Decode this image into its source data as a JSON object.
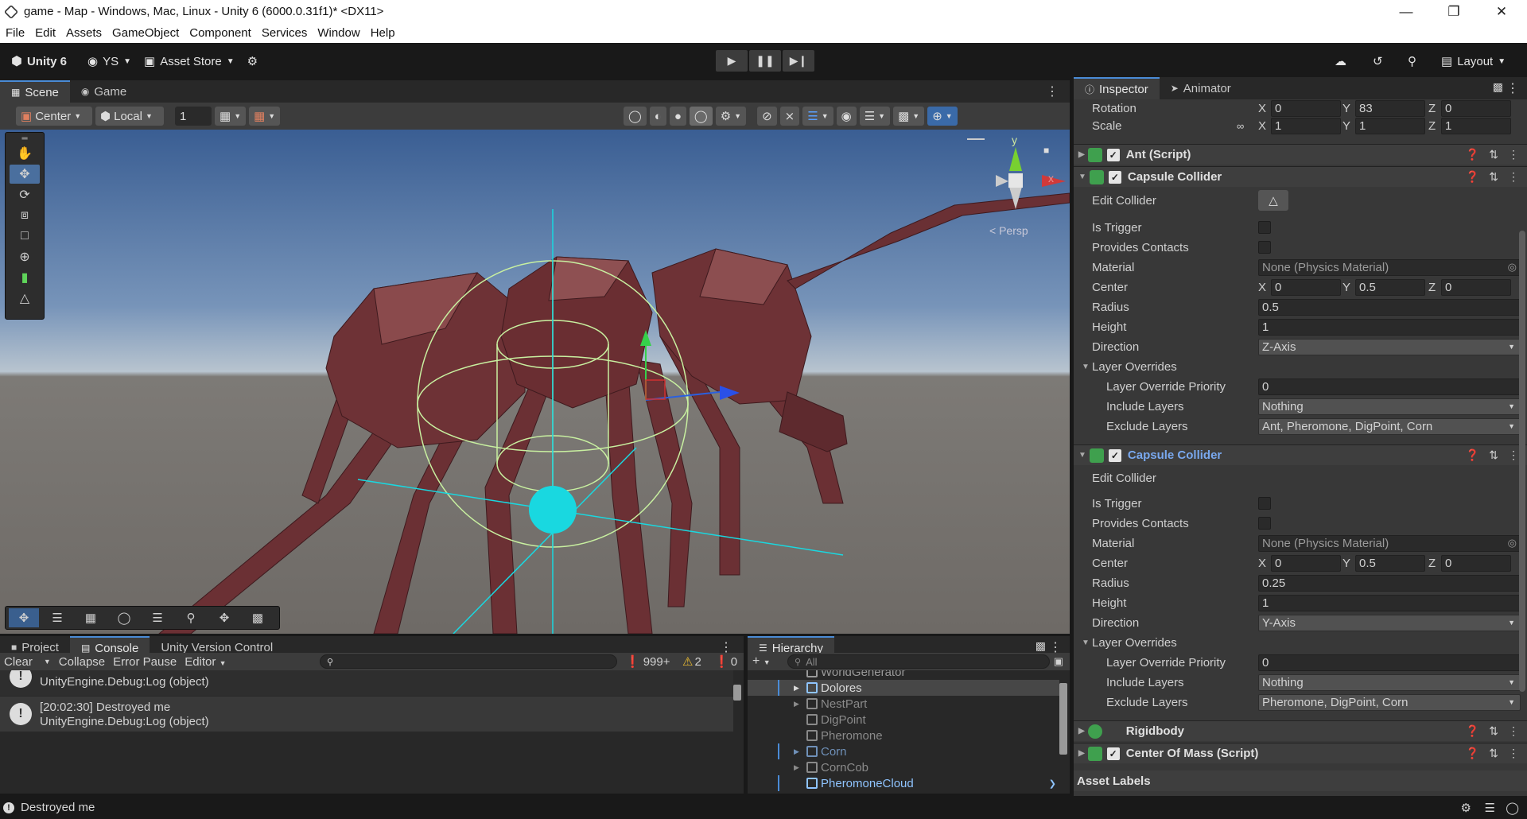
{
  "window": {
    "title": "game - Map - Windows, Mac, Linux - Unity 6 (6000.0.31f1)* <DX11>"
  },
  "menu": [
    "File",
    "Edit",
    "Assets",
    "GameObject",
    "Component",
    "Services",
    "Window",
    "Help"
  ],
  "toolbar": {
    "unity_label": "Unity 6",
    "account_label": "YS",
    "asset_store_label": "Asset Store",
    "layout_label": "Layout"
  },
  "scene": {
    "tabs": {
      "scene": "Scene",
      "game": "Game"
    },
    "pivot_label": "Center",
    "space_label": "Local",
    "grid_value": "1",
    "persp_label": "< Persp",
    "gizmo_y": "y",
    "gizmo_x": "x"
  },
  "inspector": {
    "tabs": {
      "inspector": "Inspector",
      "animator": "Animator"
    },
    "rotation": {
      "label": "Rotation",
      "x": "0",
      "y": "83",
      "z": "0"
    },
    "scale": {
      "label": "Scale",
      "x": "1",
      "y": "1",
      "z": "1"
    },
    "components": {
      "ant_script": "Ant (Script)",
      "rigidbody": "Rigidbody",
      "center_of_mass": "Center Of Mass (Script)"
    },
    "collider1": {
      "title": "Capsule Collider",
      "edit_collider": "Edit Collider",
      "is_trigger": "Is Trigger",
      "provides_contacts": "Provides Contacts",
      "material_label": "Material",
      "material": "None (Physics Material)",
      "center_label": "Center",
      "center_x": "0",
      "center_y": "0.5",
      "center_z": "0",
      "radius_label": "Radius",
      "radius": "0.5",
      "height_label": "Height",
      "height": "1",
      "direction_label": "Direction",
      "direction": "Z-Axis",
      "layer_overrides": "Layer Overrides",
      "priority_label": "Layer Override Priority",
      "priority": "0",
      "include_label": "Include Layers",
      "include": "Nothing",
      "exclude_label": "Exclude Layers",
      "exclude": "Ant, Pheromone, DigPoint, Corn"
    },
    "collider2": {
      "title": "Capsule Collider",
      "edit_collider": "Edit Collider",
      "is_trigger": "Is Trigger",
      "provides_contacts": "Provides Contacts",
      "material_label": "Material",
      "material": "None (Physics Material)",
      "center_label": "Center",
      "center_x": "0",
      "center_y": "0.5",
      "center_z": "0",
      "radius_label": "Radius",
      "radius": "0.25",
      "height_label": "Height",
      "height": "1",
      "direction_label": "Direction",
      "direction": "Y-Axis",
      "layer_overrides": "Layer Overrides",
      "priority_label": "Layer Override Priority",
      "priority": "0",
      "include_label": "Include Layers",
      "include": "Nothing",
      "exclude_label": "Exclude Layers",
      "exclude": "Pheromone, DigPoint, Corn"
    },
    "asset_labels": "Asset Labels",
    "axis": {
      "x": "X",
      "y": "Y",
      "z": "Z"
    }
  },
  "console": {
    "tabs": {
      "project": "Project",
      "console": "Console",
      "vcs": "Unity Version Control"
    },
    "clear": "Clear",
    "collapse": "Collapse",
    "error_pause": "Error Pause",
    "editor": "Editor",
    "count_logs": "999+",
    "count_warnings": "2",
    "count_errors": "0",
    "entries": [
      {
        "line1": "",
        "line2": "UnityEngine.Debug:Log (object)"
      },
      {
        "line1": "[20:02:30] Destroyed me",
        "line2": "UnityEngine.Debug:Log (object)"
      }
    ]
  },
  "hierarchy": {
    "tab": "Hierarchy",
    "search_placeholder": "All",
    "items": [
      "WorldGenerator",
      "Dolores",
      "NestPart",
      "DigPoint",
      "Pheromone",
      "Corn",
      "CornCob",
      "PheromoneCloud"
    ]
  },
  "status": {
    "message": "Destroyed me"
  },
  "colors": {
    "selection_blue": "#4a8bd6",
    "component_green": "#3fa04e",
    "ant_body": "#6e3236",
    "collider_gizmo": "#c8f0a0",
    "handle_cyan": "#19d8e0"
  }
}
